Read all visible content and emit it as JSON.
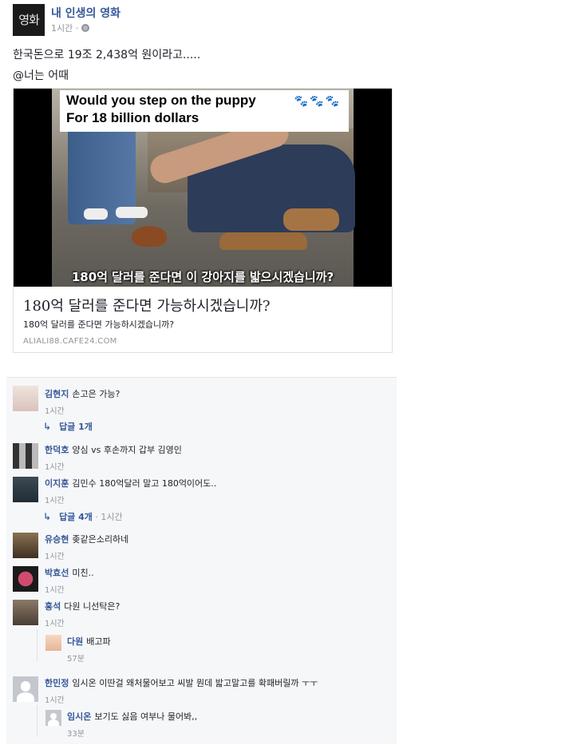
{
  "post": {
    "page_name": "내 인생의 영화",
    "avatar_text": "영화",
    "time": "1시간 ·",
    "text_line1": "한국돈으로 19조 2,438억 원이라고.....",
    "text_line2": "@너는 어때"
  },
  "link": {
    "image_top_line1": "Would you step on the puppy",
    "image_top_line2": "For 18 billion dollars",
    "image_bottom": "180억 달러를 준다면 이 강아지를 밟으시겠습니까?",
    "title": "180억 달러를 준다면 가능하시겠습니까?",
    "description": "180억 달러를 준다면 가능하시겠습니까?",
    "domain": "ALIALI88.CAFE24.COM"
  },
  "comments": [
    {
      "name": "김현지",
      "text": "손고은 가능?",
      "time": "1시간",
      "replies": "답글 1개"
    },
    {
      "name": "한덕호",
      "text": "양심 vs 후손까지 갑부 김영인",
      "time": "1시간"
    },
    {
      "name": "이지훈",
      "text": "김민수 180억달러 말고 180억이어도..",
      "time": "1시간",
      "replies": "답글 4개",
      "replies_time": "1시간"
    },
    {
      "name": "유승현",
      "text": "좆같은소리하네",
      "time": "1시간"
    },
    {
      "name": "박효선",
      "text": "미친..",
      "time": "1시간"
    },
    {
      "name": "홍석",
      "text": "다원 니선탁은?",
      "time": "1시간"
    },
    {
      "name": "다원",
      "text": "배고파",
      "time": "57분"
    },
    {
      "name": "한민정",
      "text": "임시온 이딴걸 왜처물어보고 씨발 뭔데 밟고말고를 확패버릴까 ㅜㅜ",
      "time": "1시간"
    },
    {
      "name": "임시온",
      "text": "보기도 싫음 여부나 물어봐,,",
      "time": "33분"
    }
  ]
}
